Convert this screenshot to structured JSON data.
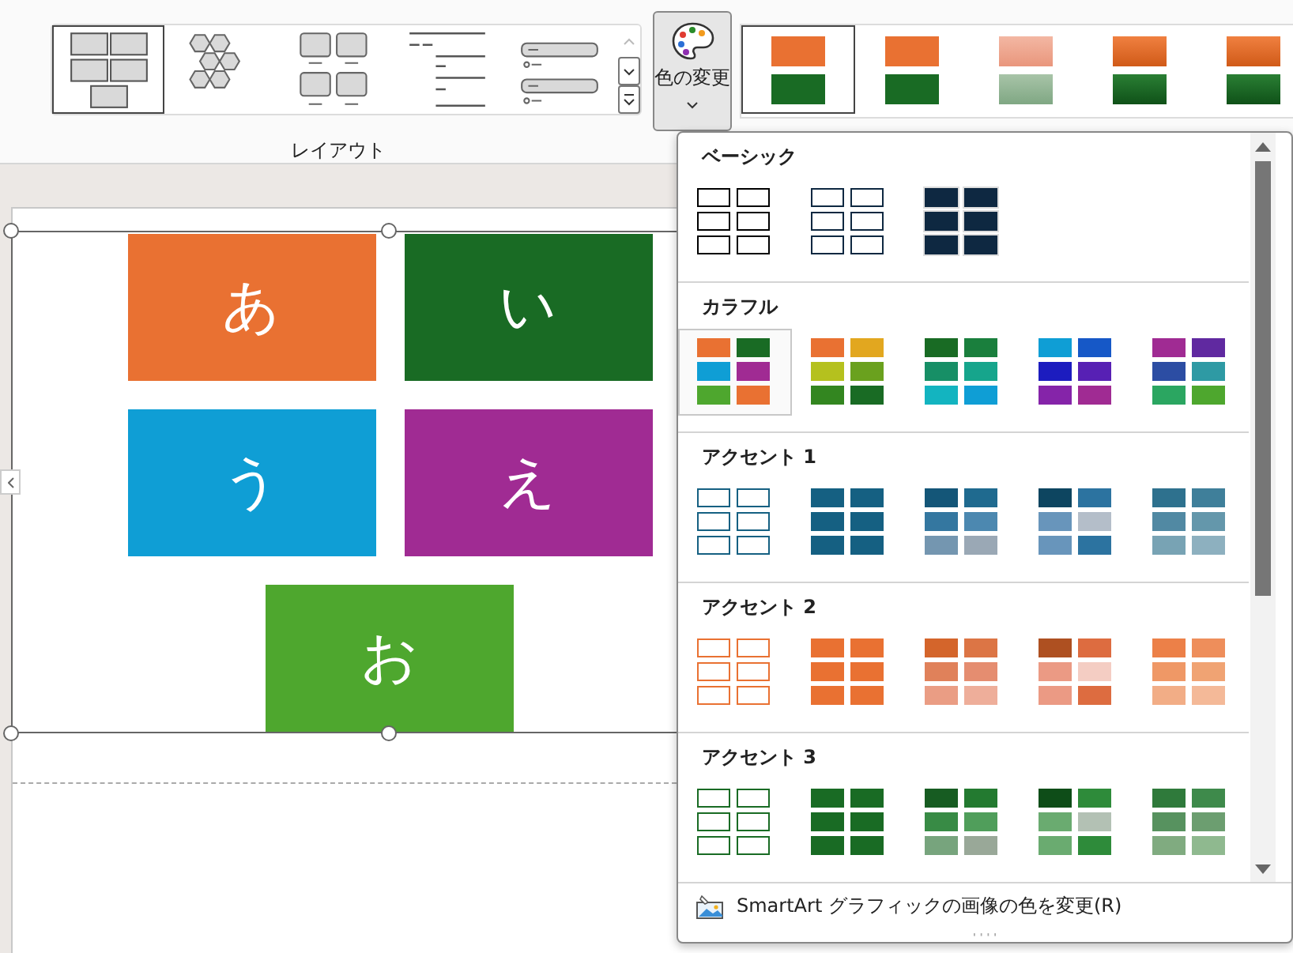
{
  "ribbon": {
    "layout_group": {
      "label": "レイアウト",
      "options": [
        {
          "kind": "org-grid",
          "selected": true
        },
        {
          "kind": "hexagons",
          "selected": false
        },
        {
          "kind": "picture-grid",
          "selected": false
        },
        {
          "kind": "list",
          "selected": false
        },
        {
          "kind": "bars",
          "selected": false
        }
      ]
    },
    "change_colors_button": {
      "label": "色の変更"
    },
    "style_options": [
      {
        "kind": "flat",
        "selected": true
      },
      {
        "kind": "flat",
        "selected": false
      },
      {
        "kind": "faded",
        "selected": false
      },
      {
        "kind": "gradient",
        "selected": false
      },
      {
        "kind": "gradient",
        "selected": false
      }
    ]
  },
  "slide": {
    "smartart_rows": [
      {
        "shapes": [
          {
            "label": "あ",
            "color": "#e97132"
          },
          {
            "label": "い",
            "color": "#196b24"
          }
        ]
      },
      {
        "shapes": [
          {
            "label": "う",
            "color": "#0f9ed5"
          },
          {
            "label": "え",
            "color": "#a02b93"
          }
        ]
      },
      {
        "shapes": [
          {
            "label": "お",
            "color": "#4ea72e"
          }
        ]
      }
    ]
  },
  "color_menu": {
    "sections": [
      {
        "title": "ベーシック",
        "options": [
          {
            "kind": "outline",
            "color": "#000000",
            "selected": false
          },
          {
            "kind": "outline",
            "color": "#0e2841",
            "selected": false
          },
          {
            "kind": "bordered",
            "swatches": [
              {
                "color": "#0e2841"
              },
              {
                "color": "#0e2841"
              },
              {
                "color": "#0e2841"
              },
              {
                "color": "#0e2841"
              },
              {
                "color": "#0e2841"
              },
              {
                "color": "#0e2841"
              }
            ],
            "selected": false
          }
        ]
      },
      {
        "title": "カラフル",
        "options": [
          {
            "kind": "filled",
            "swatches": [
              {
                "color": "#e97132"
              },
              {
                "color": "#196b24"
              },
              {
                "color": "#0f9ed5"
              },
              {
                "color": "#a02b93"
              },
              {
                "color": "#4ea72e"
              },
              {
                "color": "#e97132"
              }
            ],
            "selected": true
          },
          {
            "kind": "filled",
            "swatches": [
              {
                "color": "#e97132"
              },
              {
                "color": "#e2a71f"
              },
              {
                "color": "#b5c11e"
              },
              {
                "color": "#6aa11e"
              },
              {
                "color": "#338620"
              },
              {
                "color": "#196b24"
              }
            ],
            "selected": false
          },
          {
            "kind": "filled",
            "swatches": [
              {
                "color": "#196b24"
              },
              {
                "color": "#1a7f3d"
              },
              {
                "color": "#178f66"
              },
              {
                "color": "#16a58c"
              },
              {
                "color": "#13b4c0"
              },
              {
                "color": "#0f9ed5"
              }
            ],
            "selected": false
          },
          {
            "kind": "filled",
            "swatches": [
              {
                "color": "#0f9ed5"
              },
              {
                "color": "#1658c7"
              },
              {
                "color": "#1c1cbf"
              },
              {
                "color": "#5720b4"
              },
              {
                "color": "#8524a9"
              },
              {
                "color": "#a02b93"
              }
            ],
            "selected": false
          },
          {
            "kind": "filled",
            "swatches": [
              {
                "color": "#a02b93"
              },
              {
                "color": "#6029a0"
              },
              {
                "color": "#2c4da3"
              },
              {
                "color": "#2e9aa4"
              },
              {
                "color": "#2ba661"
              },
              {
                "color": "#4ea72e"
              }
            ],
            "selected": false
          }
        ]
      },
      {
        "title": "アクセント 1",
        "options": [
          {
            "kind": "outline",
            "color": "#156082",
            "selected": false
          },
          {
            "kind": "filled",
            "swatches": [
              {
                "color": "#156082"
              },
              {
                "color": "#156082"
              },
              {
                "color": "#156082"
              },
              {
                "color": "#156082"
              },
              {
                "color": "#156082"
              },
              {
                "color": "#156082"
              }
            ],
            "selected": false
          },
          {
            "kind": "filled",
            "swatches": [
              {
                "color": "#145678"
              },
              {
                "color": "#1f6a8f"
              },
              {
                "color": "#3477a0"
              },
              {
                "color": "#4c88b0"
              },
              {
                "color": "#7496b0"
              },
              {
                "color": "#9aa8b5"
              }
            ],
            "selected": false
          },
          {
            "kind": "filled",
            "swatches": [
              {
                "color": "#0d4560"
              },
              {
                "color": "#2c73a0"
              },
              {
                "color": "#6895bb"
              },
              {
                "color": "#b4bec9"
              },
              {
                "color": "#6895bb"
              },
              {
                "color": "#2c73a0"
              }
            ],
            "selected": false
          },
          {
            "kind": "filled",
            "swatches": [
              {
                "color": "#2e718e"
              },
              {
                "color": "#3f7f9a"
              },
              {
                "color": "#5189a3"
              },
              {
                "color": "#6497ab"
              },
              {
                "color": "#78a3b4"
              },
              {
                "color": "#8db0bf"
              }
            ],
            "selected": false
          }
        ]
      },
      {
        "title": "アクセント 2",
        "options": [
          {
            "kind": "outline",
            "color": "#e97132",
            "selected": false
          },
          {
            "kind": "filled",
            "swatches": [
              {
                "color": "#e97132"
              },
              {
                "color": "#e97132"
              },
              {
                "color": "#e97132"
              },
              {
                "color": "#e97132"
              },
              {
                "color": "#e97132"
              },
              {
                "color": "#e97132"
              }
            ],
            "selected": false
          },
          {
            "kind": "filled",
            "swatches": [
              {
                "color": "#d4652b"
              },
              {
                "color": "#dc7545"
              },
              {
                "color": "#e0815a"
              },
              {
                "color": "#e58d70"
              },
              {
                "color": "#ea9d84"
              },
              {
                "color": "#eeae9a"
              }
            ],
            "selected": false
          },
          {
            "kind": "filled",
            "swatches": [
              {
                "color": "#ae5021"
              },
              {
                "color": "#dd6c40"
              },
              {
                "color": "#eb9a84"
              },
              {
                "color": "#f4cdc3"
              },
              {
                "color": "#eb9a84"
              },
              {
                "color": "#dd6c40"
              }
            ],
            "selected": false
          },
          {
            "kind": "filled",
            "swatches": [
              {
                "color": "#ec8048"
              },
              {
                "color": "#ee8e5b"
              },
              {
                "color": "#ef9866"
              },
              {
                "color": "#f0a373"
              },
              {
                "color": "#f2ad86"
              },
              {
                "color": "#f4b998"
              }
            ],
            "selected": false
          }
        ]
      },
      {
        "title": "アクセント 3",
        "options": [
          {
            "kind": "outline",
            "color": "#196b24",
            "selected": false
          },
          {
            "kind": "filled",
            "swatches": [
              {
                "color": "#196b24"
              },
              {
                "color": "#196b24"
              },
              {
                "color": "#196b24"
              },
              {
                "color": "#196b24"
              },
              {
                "color": "#196b24"
              },
              {
                "color": "#196b24"
              }
            ],
            "selected": false
          },
          {
            "kind": "filled",
            "swatches": [
              {
                "color": "#175c22"
              },
              {
                "color": "#237a30"
              },
              {
                "color": "#388b45"
              },
              {
                "color": "#509e5b"
              },
              {
                "color": "#77a47d"
              },
              {
                "color": "#99a898"
              }
            ],
            "selected": false
          },
          {
            "kind": "filled",
            "swatches": [
              {
                "color": "#0e4d18"
              },
              {
                "color": "#2e8b3a"
              },
              {
                "color": "#6aab70"
              },
              {
                "color": "#b3c1b4"
              },
              {
                "color": "#6aab70"
              },
              {
                "color": "#2e8b3a"
              }
            ],
            "selected": false
          },
          {
            "kind": "filled",
            "swatches": [
              {
                "color": "#2f7a3b"
              },
              {
                "color": "#3e8a4b"
              },
              {
                "color": "#57925f"
              },
              {
                "color": "#6c9e70"
              },
              {
                "color": "#80ab80"
              },
              {
                "color": "#8fb98f"
              }
            ],
            "selected": false
          }
        ]
      }
    ],
    "footer_item": {
      "label": "SmartArt グラフィックの画像の色を変更(R)"
    }
  }
}
